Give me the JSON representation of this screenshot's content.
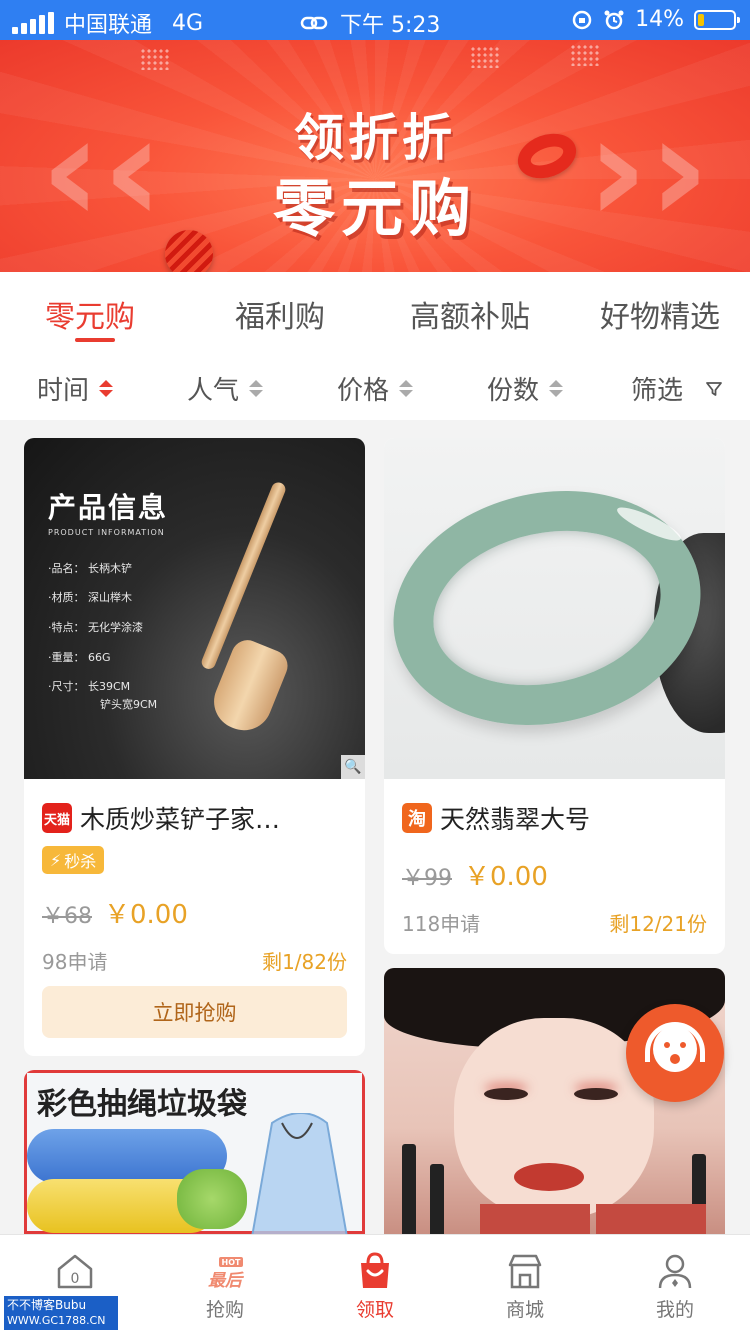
{
  "status_bar": {
    "carrier": "中国联通",
    "network": "4G",
    "time": "下午 5:23",
    "battery": "14%"
  },
  "banner": {
    "line1": "领折折",
    "line2": "零元购"
  },
  "tabs": [
    {
      "label": "零元购",
      "active": true
    },
    {
      "label": "福利购",
      "active": false
    },
    {
      "label": "高额补贴",
      "active": false
    },
    {
      "label": "好物精选",
      "active": false
    }
  ],
  "sort_options": [
    {
      "label": "时间",
      "active": true
    },
    {
      "label": "人气",
      "active": false
    },
    {
      "label": "价格",
      "active": false
    },
    {
      "label": "份数",
      "active": false
    }
  ],
  "filter_label": "筛选",
  "products": [
    {
      "name": "木质炒菜铲子家…",
      "shop_badge": "天猫",
      "tag": "秒杀",
      "original_price": "￥68",
      "price": "￥0.00",
      "applied": "98申请",
      "remaining": "剩1/82份",
      "button": "立即抢购",
      "image": {
        "title": "产品信息",
        "subtitle": "PRODUCT INFORMATION",
        "specs": [
          "·品名：  长柄木铲",
          "·材质：  深山榉木",
          "·特点：  无化学涂漆",
          "·重量：  66G",
          "·尺寸：  长39CM",
          "铲头宽9CM"
        ]
      }
    },
    {
      "name": "天然翡翠大号",
      "shop_badge": "淘",
      "original_price": "￥99",
      "price": "￥0.00",
      "applied": "118申请",
      "remaining": "剩12/21份"
    },
    {
      "image_title": "彩色抽绳垃圾袋"
    }
  ],
  "bottom_nav": [
    {
      "label": "",
      "icon": "home-icon",
      "badge": "0"
    },
    {
      "label": "抢购",
      "icon": "hot-last-icon",
      "badge_top": "HOT",
      "badge_text": "最后"
    },
    {
      "label": "领取",
      "icon": "shopping-bag-icon",
      "active": true
    },
    {
      "label": "商城",
      "icon": "store-icon"
    },
    {
      "label": "我的",
      "icon": "profile-icon"
    }
  ],
  "watermark": {
    "line1": "不不博客Bubu",
    "line2": "WWW.GC1788.CN"
  },
  "colors": {
    "accent": "#e93c30",
    "price": "#e8a226",
    "status_bar": "#2f7ff2"
  }
}
